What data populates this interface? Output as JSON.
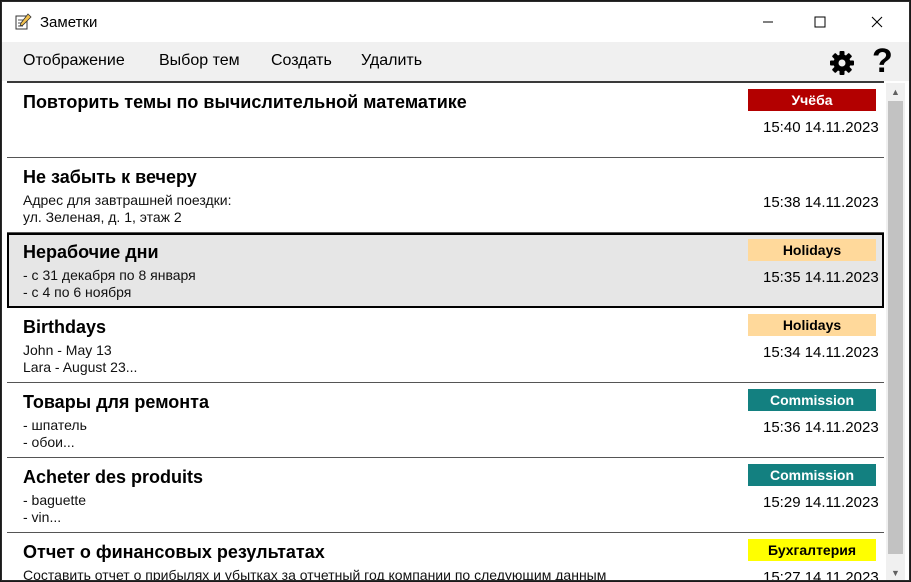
{
  "window": {
    "title": "Заметки",
    "app_icon": "notepad-icon"
  },
  "menu": [
    {
      "label": "Отображение"
    },
    {
      "label": "Выбор тем"
    },
    {
      "label": "Создать"
    },
    {
      "label": "Удалить"
    }
  ],
  "toolbar": {
    "settings_icon": "gear-icon",
    "help_label": "?"
  },
  "notes": [
    {
      "title": "Повторить темы по вычислительной математике",
      "body": "",
      "tag": "Учёба",
      "tag_bg": "#b30000",
      "tag_fg": "#ffffff",
      "timestamp": "15:40 14.11.2023"
    },
    {
      "title": "Не забыть к вечеру",
      "body": "Адрес для завтрашней поездки:\nул. Зеленая, д. 1, этаж 2",
      "tag": "",
      "tag_bg": "",
      "tag_fg": "",
      "timestamp": "15:38 14.11.2023"
    },
    {
      "title": "Нерабочие дни",
      "body": "- с 31 декабря по 8 января\n- с 4 по 6 ноября",
      "tag": "Holidays",
      "tag_bg": "#ffd99b",
      "tag_fg": "#000000",
      "timestamp": "15:35 14.11.2023",
      "selected": true
    },
    {
      "title": "Birthdays",
      "body": "John - May 13\nLara - August 23...",
      "tag": "Holidays",
      "tag_bg": "#ffd99b",
      "tag_fg": "#000000",
      "timestamp": "15:34 14.11.2023"
    },
    {
      "title": "Товары для ремонта",
      "body": "- шпатель\n- обои...",
      "tag": "Commission",
      "tag_bg": "#138080",
      "tag_fg": "#ffffff",
      "timestamp": "15:36 14.11.2023"
    },
    {
      "title": "Acheter des produits",
      "body": "- baguette\n- vin...",
      "tag": "Commission",
      "tag_bg": "#138080",
      "tag_fg": "#ffffff",
      "timestamp": "15:29 14.11.2023"
    },
    {
      "title": "Отчет о финансовых результатах",
      "body": "Составить отчет о прибылях и убытках за отчетный год компании по следующим данным",
      "tag": "Бухгалтерия",
      "tag_bg": "#ffff00",
      "tag_fg": "#000000",
      "timestamp": "15:27 14.11.2023"
    }
  ]
}
